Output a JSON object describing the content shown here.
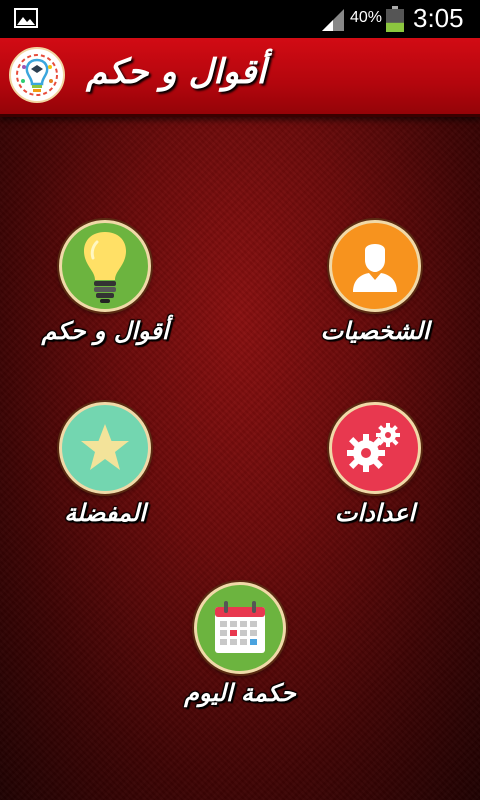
{
  "status_bar": {
    "battery_percent": "40%",
    "battery_level": 0.4,
    "time": "3:05",
    "icons": [
      "gallery-icon",
      "signal-icon",
      "battery-icon"
    ]
  },
  "app_bar": {
    "title": "أقوال و حكم",
    "logo": "lightbulb-logo-icon"
  },
  "menu": [
    {
      "id": "people",
      "label": "الشخصيات",
      "icon": "person-icon",
      "color": "#f7931e"
    },
    {
      "id": "quotes",
      "label": "أقوال و حكم",
      "icon": "lightbulb-icon",
      "color": "#6cb43f"
    },
    {
      "id": "settings",
      "label": "اعدادات",
      "icon": "gears-icon",
      "color": "#e8384f"
    },
    {
      "id": "favorites",
      "label": "المفضلة",
      "icon": "star-icon",
      "color": "#73d6b0"
    },
    {
      "id": "daily",
      "label": "حكمة اليوم",
      "icon": "calendar-icon",
      "color": "#6cb43f"
    }
  ],
  "colors": {
    "app_bar": "#c4080f",
    "background": "#6a0a0a",
    "circle_border": "#f0d9a8"
  }
}
